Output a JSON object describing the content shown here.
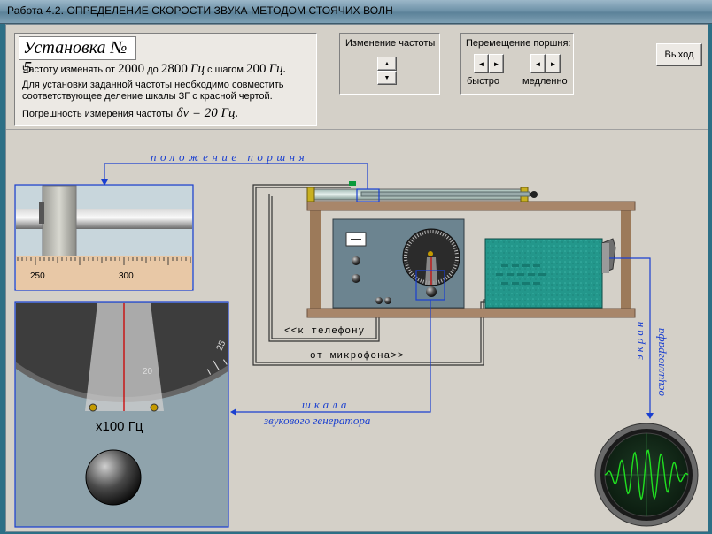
{
  "window": {
    "title": "Работа 4.2. ОПРЕДЕЛЕНИЕ СКОРОСТИ ЗВУКА МЕТОДОМ СТОЯЧИХ ВОЛН"
  },
  "info": {
    "heading": "Установка № 5",
    "line1_a": "Частоту изменять от",
    "line1_from": "2000",
    "line1_to_word": "до",
    "line1_to": "2800",
    "line1_unit": "Гц",
    "line1_step_word": "с шагом",
    "line1_step": "200",
    "line1_step_unit": "Гц.",
    "line2": "Для установки заданной частоты необходимо совместить",
    "line3": "соответствующее деление шкалы ЗГ с красной чертой.",
    "line4_a": "Погрешность измерения частоты",
    "line4_b": "δν = 20 Гц."
  },
  "freq_control": {
    "label": "Изменение частоты",
    "up": "▲",
    "down": "▼"
  },
  "piston_control": {
    "label": "Перемещение поршня:",
    "fast": "быстро",
    "slow": "медленно",
    "left": "◄",
    "right": "►"
  },
  "exit_button": "Выход",
  "labels": {
    "piston_position": "положение поршня",
    "to_phone": "<<к телефону",
    "from_mic": "от микрофона>>",
    "scale_1": "шкала",
    "scale_2": "звукового генератора",
    "osc_1": "экран",
    "osc_2": "осциллографа",
    "mult": "x100 Гц"
  },
  "ruler": {
    "ticks": [
      "250",
      "300"
    ]
  },
  "dial": {
    "ticks": [
      "20",
      "25"
    ]
  },
  "colors": {
    "accent_blue": "#1a3fd0",
    "pointer_red": "#cc0000",
    "osc_green": "#20e020",
    "board_teal": "#1f8f84"
  }
}
